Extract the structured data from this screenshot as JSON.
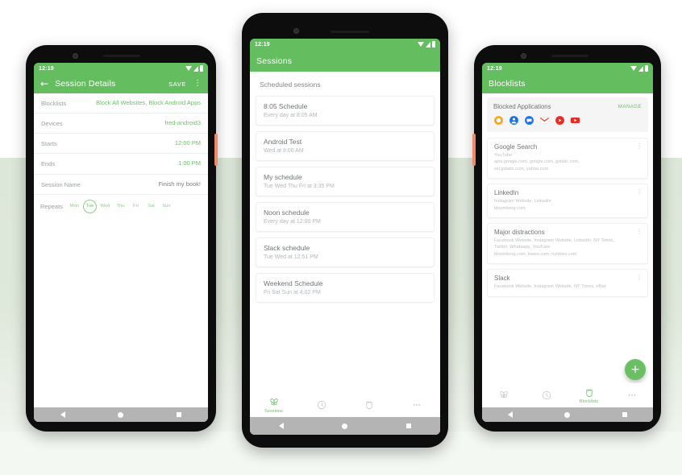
{
  "theme": {
    "green": "#64bd5f",
    "green_text": "#6ec16a",
    "band_bg": "#dde7d9",
    "page_bg": "#ffffff",
    "side_button": "#ef8a6e"
  },
  "phone1": {
    "status": {
      "time": "12:19",
      "icons": [
        "wifi-icon",
        "signal-icon",
        "battery-icon"
      ]
    },
    "appbar": {
      "back": "←",
      "title": "Session Details",
      "save": "SAVE",
      "overflow": "⋮"
    },
    "rows": [
      {
        "label": "Blocklists",
        "value": "Block All Websites, Block Android Apps",
        "accent": true
      },
      {
        "label": "Devices",
        "value": "fred-android3",
        "accent": true
      },
      {
        "label": "Starts",
        "value": "12:00 PM",
        "accent": true
      },
      {
        "label": "Ends",
        "value": "1:00 PM",
        "accent": true
      },
      {
        "label": "Session Name",
        "value": "Finish my book!",
        "accent": false
      }
    ],
    "repeats": {
      "label": "Repeats",
      "days": [
        {
          "name": "Mon",
          "selected": false
        },
        {
          "name": "Tue",
          "selected": true
        },
        {
          "name": "Wed",
          "selected": false
        },
        {
          "name": "Thu",
          "selected": false
        },
        {
          "name": "Fri",
          "selected": false
        },
        {
          "name": "Sat",
          "selected": false
        },
        {
          "name": "Sun",
          "selected": false
        }
      ]
    }
  },
  "phone2": {
    "status": {
      "time": "12:19"
    },
    "appbar": {
      "title": "Sessions"
    },
    "section_header": "Scheduled sessions",
    "sessions": [
      {
        "title": "8:05 Schedule",
        "subtitle": "Every day at 8:05 AM"
      },
      {
        "title": "Android Test",
        "subtitle": "Wed at 8:00 AM"
      },
      {
        "title": "My schedule",
        "subtitle": "Tue Wed Thu Fri at 3:35 PM"
      },
      {
        "title": "Noon schedule",
        "subtitle": "Every day at 12:00 PM"
      },
      {
        "title": "Slack schedule",
        "subtitle": "Tue Wed at 12:51 PM"
      },
      {
        "title": "Weekend Schedule",
        "subtitle": "Fri Sat Sun at 4:02 PM"
      }
    ],
    "tabs": [
      {
        "label": "Sessions",
        "icon": "butterfly-icon",
        "active": true
      },
      {
        "label": "",
        "icon": "clock-icon",
        "active": false
      },
      {
        "label": "",
        "icon": "shield-icon",
        "active": false
      },
      {
        "label": "",
        "icon": "more-icon",
        "active": false
      }
    ]
  },
  "phone3": {
    "status": {
      "time": "12:19"
    },
    "appbar": {
      "title": "Blocklists"
    },
    "blocked_apps": {
      "title": "Blocked Applications",
      "manage": "MANAGE",
      "apps": [
        {
          "name": "firefox-icon",
          "color": "#f5a623"
        },
        {
          "name": "contacts-icon",
          "color": "#1a73e8"
        },
        {
          "name": "messages-icon",
          "color": "#1a73e8"
        },
        {
          "name": "gmail-icon",
          "color": "#ea4335"
        },
        {
          "name": "youtube-music-icon",
          "color": "#e52d27"
        },
        {
          "name": "youtube-icon",
          "color": "#e52d27"
        }
      ]
    },
    "blocklists": [
      {
        "title": "Google Search",
        "lines": [
          "YouTube",
          "apis.google.com, google.com, gstatic.com,",
          "ssl.gstatic.com, yahoo.com"
        ]
      },
      {
        "title": "LinkedIn",
        "lines": [
          "Instagram Website, LinkedIn",
          "bloomberg.com"
        ]
      },
      {
        "title": "Major distractions",
        "lines": [
          "Facebook Website, Instagram Website, LinkedIn, NY Times,",
          "Twitter, Whatsapp, YouTube",
          "bloomberg.com, lowes.com, nytimes.com"
        ]
      },
      {
        "title": "Slack",
        "lines": [
          "Facebook Website, Instagram Website, NY Times, eBay"
        ]
      }
    ],
    "fab": {
      "label": "+",
      "name": "add-blocklist-fab"
    },
    "tabs": [
      {
        "label": "",
        "icon": "butterfly-icon",
        "active": false
      },
      {
        "label": "",
        "icon": "clock-icon",
        "active": false
      },
      {
        "label": "Blocklists",
        "icon": "shield-icon",
        "active": true
      },
      {
        "label": "",
        "icon": "more-icon",
        "active": false
      }
    ]
  }
}
